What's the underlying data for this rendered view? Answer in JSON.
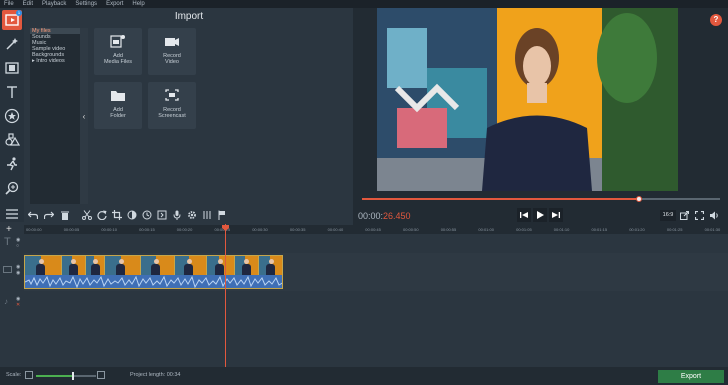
{
  "menu": [
    "File",
    "Edit",
    "Playback",
    "Settings",
    "Export",
    "Help"
  ],
  "left_tools": {
    "import_badge": "1",
    "items": [
      "import-icon",
      "magic-wand-icon",
      "film-filters-icon",
      "text-icon",
      "stickers-star-icon",
      "shapes-icon",
      "running-man-icon",
      "zoom-icon",
      "more-menu-icon"
    ]
  },
  "import_panel": {
    "title": "Import",
    "tree": [
      "My files",
      "Sounds",
      "Music",
      "Sample video",
      "Backgrounds",
      "▸ Intro videos"
    ],
    "tiles": [
      {
        "label": "Add\nMedia Files",
        "icon": "media-files-icon"
      },
      {
        "label": "Record\nVideo",
        "icon": "camera-icon"
      },
      {
        "label": "Add\nFolder",
        "icon": "folder-icon"
      },
      {
        "label": "Record\nScreencast",
        "icon": "screencast-icon"
      }
    ]
  },
  "player": {
    "time_main": "00:00:",
    "time_ms": "26.450",
    "progress": 0.775,
    "aspect": "16:9",
    "help": "?"
  },
  "timeline": {
    "ruler": [
      "00:00:00",
      "00:00:05",
      "00:00:10",
      "00:00:15",
      "00:00:20",
      "00:00:25",
      "00:00:30",
      "00:00:35",
      "00:00:40",
      "00:00:45",
      "00:00:50",
      "00:00:55",
      "00:01:00",
      "00:01:05",
      "00:01:10",
      "00:01:15",
      "00:01:20",
      "00:01:25",
      "00:01:30"
    ],
    "playhead_fraction": 0.287
  },
  "footer": {
    "scale_label": "Scale:",
    "zoom_level": 0.6,
    "project_length_label": "Project length:",
    "project_length": "00:34",
    "export_label": "Export"
  },
  "colors": {
    "accent": "#e2583e",
    "export": "#2e7d46",
    "audio": "#4a7ec2"
  }
}
